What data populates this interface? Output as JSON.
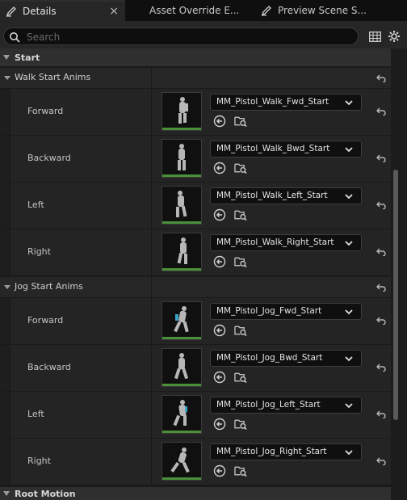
{
  "tabs": [
    {
      "label": "Details",
      "icon": "pencil-icon",
      "active": true,
      "close": "×"
    },
    {
      "label": "Asset Override E...",
      "active": false
    },
    {
      "label": "Preview Scene S...",
      "icon": "pencil-icon",
      "active": false
    }
  ],
  "search": {
    "placeholder": "Search",
    "value": ""
  },
  "toolbar": {
    "table_icon": "table-icon",
    "settings_icon": "gear-icon"
  },
  "categories": {
    "start": {
      "label": "Start"
    },
    "root_motion": {
      "label": "Root Motion"
    }
  },
  "groups": [
    {
      "label": "Walk Start Anims",
      "rows": [
        {
          "label": "Forward",
          "asset": "MM_Pistol_Walk_Fwd_Start"
        },
        {
          "label": "Backward",
          "asset": "MM_Pistol_Walk_Bwd_Start"
        },
        {
          "label": "Left",
          "asset": "MM_Pistol_Walk_Left_Start"
        },
        {
          "label": "Right",
          "asset": "MM_Pistol_Walk_Right_Start"
        }
      ]
    },
    {
      "label": "Jog Start Anims",
      "rows": [
        {
          "label": "Forward",
          "asset": "MM_Pistol_Jog_Fwd_Start"
        },
        {
          "label": "Backward",
          "asset": "MM_Pistol_Jog_Bwd_Start"
        },
        {
          "label": "Left",
          "asset": "MM_Pistol_Jog_Left_Start"
        },
        {
          "label": "Right",
          "asset": "MM_Pistol_Jog_Right_Start"
        }
      ]
    }
  ],
  "colors": {
    "accent_green": "#4a8f3a",
    "panel": "#242424",
    "header": "#2f2f2f"
  }
}
